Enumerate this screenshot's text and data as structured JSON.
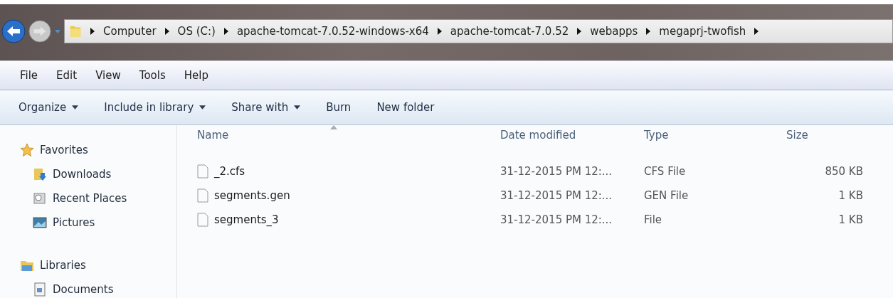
{
  "address_bar": {
    "path": [
      "Computer",
      "OS (C:)",
      "apache-tomcat-7.0.52-windows-x64",
      "apache-tomcat-7.0.52",
      "webapps",
      "megaprj-twofish"
    ]
  },
  "menu_bar": [
    "File",
    "Edit",
    "View",
    "Tools",
    "Help"
  ],
  "toolbar": [
    {
      "label": "Organize",
      "dropdown": true
    },
    {
      "label": "Include in library",
      "dropdown": true
    },
    {
      "label": "Share with",
      "dropdown": true
    },
    {
      "label": "Burn",
      "dropdown": false
    },
    {
      "label": "New folder",
      "dropdown": false
    }
  ],
  "sidebar": {
    "groups": [
      {
        "label": "Favorites",
        "kind": "star",
        "children": [
          {
            "label": "Downloads",
            "kind": "downloads"
          },
          {
            "label": "Recent Places",
            "kind": "recent"
          },
          {
            "label": "Pictures",
            "kind": "pictures"
          }
        ]
      },
      {
        "label": "Libraries",
        "kind": "library",
        "children": [
          {
            "label": "Documents",
            "kind": "documents"
          }
        ]
      }
    ]
  },
  "table": {
    "columns": [
      "Name",
      "Date modified",
      "Type",
      "Size"
    ],
    "rows": [
      {
        "name": "_2.cfs",
        "date": "31-12-2015 PM 12:...",
        "type": "CFS File",
        "size": "850 KB"
      },
      {
        "name": "segments.gen",
        "date": "31-12-2015 PM 12:...",
        "type": "GEN File",
        "size": "1 KB"
      },
      {
        "name": "segments_3",
        "date": "31-12-2015 PM 12:...",
        "type": "File",
        "size": "1 KB"
      }
    ]
  }
}
